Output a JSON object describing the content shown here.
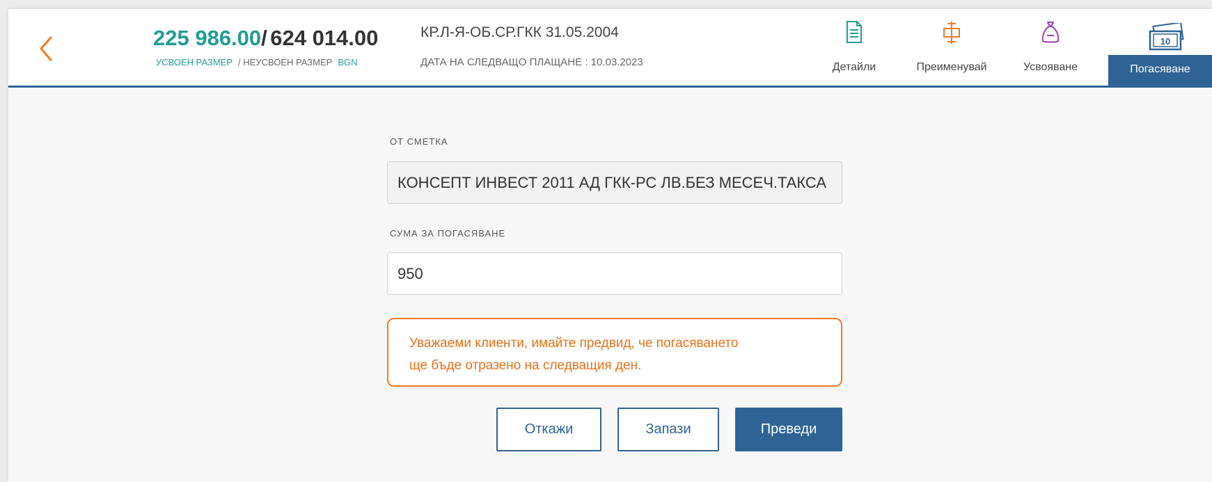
{
  "header": {
    "amount_used": "225 986.00",
    "separator": "/",
    "amount_unused": "624 014.00",
    "label_used": "УСВОЕН РАЗМЕР",
    "label_unused": "/ НЕУСВОЕН РАЗМЕР",
    "currency": "BGN",
    "account_title": "КР.Л-Я-ОБ.СР.ГКК 31.05.2004",
    "next_payment": "ДАТА НА СЛЕДВАЩО ПЛАЩАНЕ : 10.03.2023",
    "tabs": [
      {
        "label": "Детайли",
        "icon": "document-icon"
      },
      {
        "label": "Преименувай",
        "icon": "rename-icon"
      },
      {
        "label": "Усвояване",
        "icon": "money-bag-icon"
      },
      {
        "label": "Погасяване",
        "icon": "banknote-icon",
        "active": true
      }
    ]
  },
  "form": {
    "from_account_label": "ОТ СМЕТКА",
    "from_account_value": "КОНСЕПТ ИНВЕСТ 2011 АД ГКК-РС ЛВ.БЕЗ МЕСЕЧ.ТАКСА",
    "amount_label": "СУМА ЗА ПОГАСЯВАНЕ",
    "amount_value": "950",
    "notice_line1": "Уважаеми клиенти, имайте предвид, че погасяването",
    "notice_line2": "ще бъде отразено на следващия ден.",
    "cancel_label": "Откажи",
    "save_label": "Запази",
    "transfer_label": "Преведи"
  },
  "colors": {
    "primary": "#2f6396",
    "teal": "#1f9c94",
    "orange": "#f07a21"
  }
}
